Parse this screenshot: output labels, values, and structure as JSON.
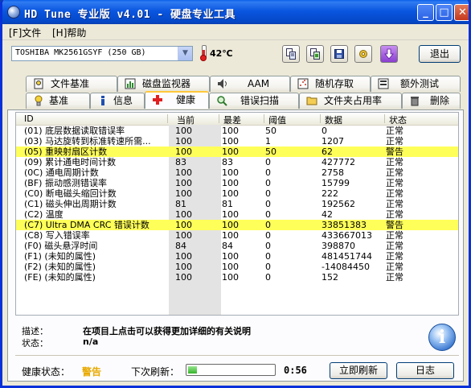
{
  "window": {
    "title": "HD Tune 专业版 v4.01 - 硬盘专业工具",
    "minimize_glyph": "_",
    "maximize_glyph": "□",
    "close_glyph": "✕"
  },
  "menu": {
    "file": "[F]文件",
    "help": "[H]帮助"
  },
  "toolbar": {
    "drive": "TOSHIBA MK2561GSYF (250 GB)",
    "temperature": "42℃",
    "exit_label": "退出",
    "icons": [
      "copy-text-icon",
      "copy-screen-icon",
      "save-icon",
      "options-icon",
      "download-icon"
    ]
  },
  "tabs_top": [
    {
      "label": "文件基准",
      "icon": "file-benchmark-icon"
    },
    {
      "label": "磁盘监视器",
      "icon": "disk-monitor-icon"
    },
    {
      "label": "AAM",
      "icon": "speaker-icon"
    },
    {
      "label": "随机存取",
      "icon": "random-access-icon"
    },
    {
      "label": "额外测试",
      "icon": "extra-tests-icon"
    }
  ],
  "tabs_bottom": [
    {
      "label": "基准",
      "icon": "benchmark-icon"
    },
    {
      "label": "信息",
      "icon": "info-icon"
    },
    {
      "label": "健康",
      "icon": "health-icon",
      "active": true
    },
    {
      "label": "错误扫描",
      "icon": "error-scan-icon"
    },
    {
      "label": "文件夹占用率",
      "icon": "folder-usage-icon"
    },
    {
      "label": "删除",
      "icon": "erase-icon"
    }
  ],
  "table": {
    "headers": {
      "id": "ID",
      "current": "当前",
      "worst": "最差",
      "threshold": "阈值",
      "data": "数据",
      "status": "状态"
    },
    "rows": [
      {
        "id": "(01) 底层数据读取错误率",
        "current": "100",
        "worst": "100",
        "threshold": "50",
        "data": "0",
        "status": "正常",
        "warn": false
      },
      {
        "id": "(03) 马达旋转到标准转速所需...",
        "current": "100",
        "worst": "100",
        "threshold": "1",
        "data": "1207",
        "status": "正常",
        "warn": false
      },
      {
        "id": "(05) 重映射扇区计数",
        "current": "100",
        "worst": "100",
        "threshold": "50",
        "data": "62",
        "status": "警告",
        "warn": true
      },
      {
        "id": "(09) 累计通电时间计数",
        "current": "83",
        "worst": "83",
        "threshold": "0",
        "data": "427772",
        "status": "正常",
        "warn": false
      },
      {
        "id": "(0C) 通电周期计数",
        "current": "100",
        "worst": "100",
        "threshold": "0",
        "data": "2758",
        "status": "正常",
        "warn": false
      },
      {
        "id": "(BF) 振动感测错误率",
        "current": "100",
        "worst": "100",
        "threshold": "0",
        "data": "15799",
        "status": "正常",
        "warn": false
      },
      {
        "id": "(C0) 断电磁头缩回计数",
        "current": "100",
        "worst": "100",
        "threshold": "0",
        "data": "222",
        "status": "正常",
        "warn": false
      },
      {
        "id": "(C1) 磁头伸出周期计数",
        "current": "81",
        "worst": "81",
        "threshold": "0",
        "data": "192562",
        "status": "正常",
        "warn": false
      },
      {
        "id": "(C2) 温度",
        "current": "100",
        "worst": "100",
        "threshold": "0",
        "data": "42",
        "status": "正常",
        "warn": false
      },
      {
        "id": "(C7) Ultra DMA CRC 错误计数",
        "current": "100",
        "worst": "100",
        "threshold": "0",
        "data": "33851383",
        "status": "警告",
        "warn": true
      },
      {
        "id": "(C8) 写入错误率",
        "current": "100",
        "worst": "100",
        "threshold": "0",
        "data": "433667013",
        "status": "正常",
        "warn": false
      },
      {
        "id": "(F0) 磁头悬浮时间",
        "current": "84",
        "worst": "84",
        "threshold": "0",
        "data": "398870",
        "status": "正常",
        "warn": false
      },
      {
        "id": "(F1) (未知的属性)",
        "current": "100",
        "worst": "100",
        "threshold": "0",
        "data": "481451744",
        "status": "正常",
        "warn": false
      },
      {
        "id": "(F2) (未知的属性)",
        "current": "100",
        "worst": "100",
        "threshold": "0",
        "data": "-14084450",
        "status": "正常",
        "warn": false
      },
      {
        "id": "(FE) (未知的属性)",
        "current": "100",
        "worst": "100",
        "threshold": "0",
        "data": "152",
        "status": "正常",
        "warn": false
      }
    ]
  },
  "details": {
    "description_label": "描述：",
    "description_value": "在项目上点击可以获得更加详细的有关说明",
    "status_label": "状态：",
    "status_value": "n/a"
  },
  "footer": {
    "health_label": "健康状态：",
    "health_value": "警告",
    "refresh_label": "下次刷新：",
    "refresh_progress": 0.1,
    "refresh_time": "0:56",
    "refresh_now": "立即刷新",
    "log": "日志"
  },
  "colors": {
    "warning_row": "#ffff5a",
    "warning_text": "#e8a900",
    "titlebar": "#0a56e0"
  }
}
